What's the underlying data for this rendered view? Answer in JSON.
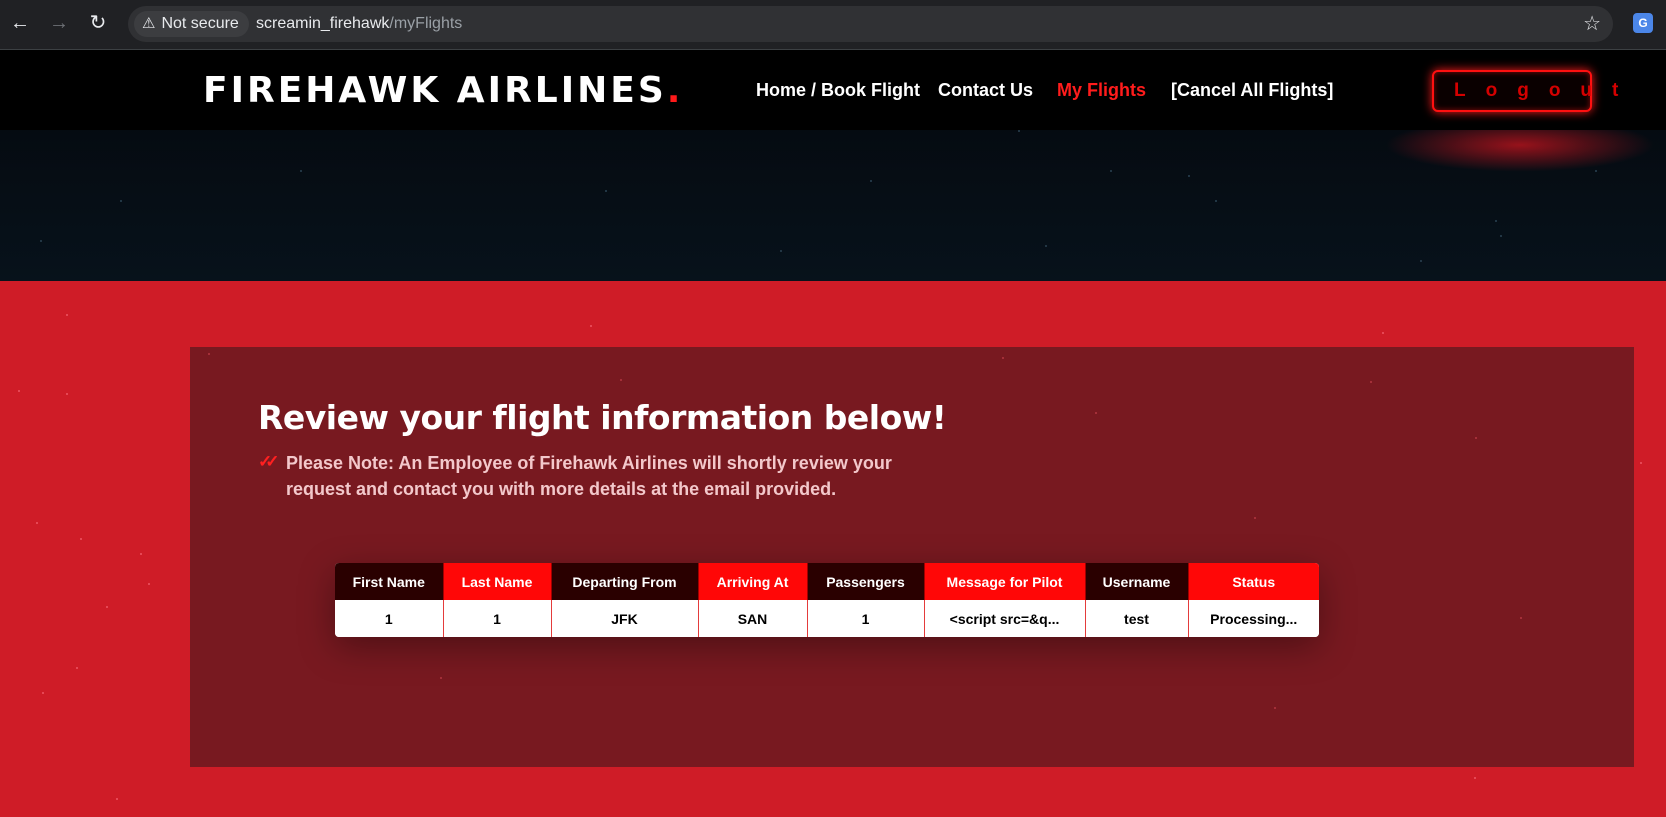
{
  "browser": {
    "security_label": "Not secure",
    "url_host": "screamin_firehawk",
    "url_path": "/myFlights"
  },
  "site": {
    "logo_text": "FIREHAWK AIRLINES",
    "logo_dot": ".",
    "nav": {
      "home": "Home / Book Flight",
      "contact": "Contact Us",
      "my_flights": "My Flights",
      "cancel_all": "[Cancel All Flights]"
    },
    "logout_label": "Logout",
    "accent_color": "#ff1c1c"
  },
  "main": {
    "title": "Review your flight information below!",
    "note": "Please Note: An Employee of Firehawk Airlines will shortly review your request and contact you with more details at the email provided."
  },
  "table": {
    "headers": [
      "First Name",
      "Last Name",
      "Departing From",
      "Arriving At",
      "Passengers",
      "Message for Pilot",
      "Username",
      "Status"
    ],
    "rows": [
      [
        "1",
        "1",
        "JFK",
        "SAN",
        "1",
        "<script src=&q...",
        "test",
        "Processing..."
      ]
    ]
  }
}
